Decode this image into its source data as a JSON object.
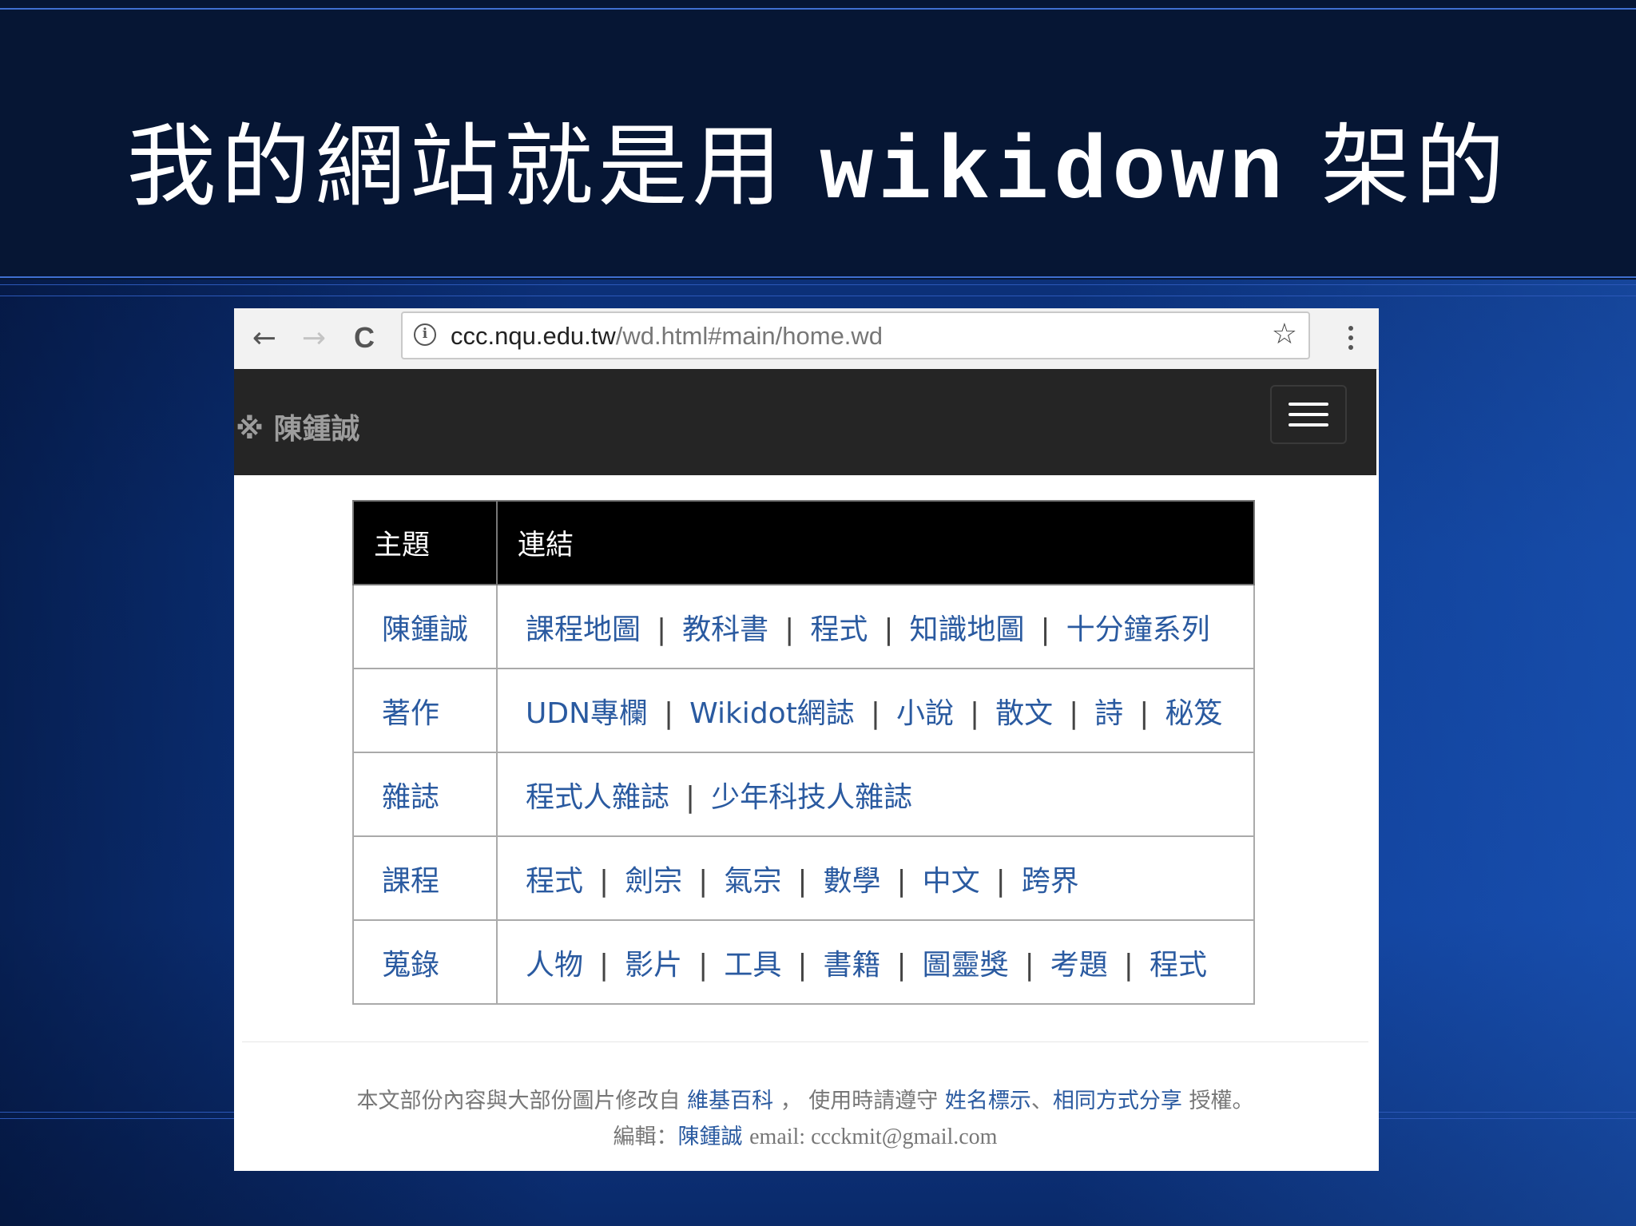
{
  "slide": {
    "title_cjk_before": "我的網站就是用",
    "title_latin": "wikidown",
    "title_cjk_after": "架的"
  },
  "browser": {
    "back_glyph": "←",
    "forward_glyph": "→",
    "reload_glyph": "C",
    "info_glyph": "i",
    "url_host": "ccc.nqu.edu.tw",
    "url_path": "/wd.html#main/home.wd",
    "star_glyph": "☆",
    "icons": [
      "back-arrow-icon",
      "forward-arrow-icon",
      "reload-icon",
      "info-icon",
      "bookmark-star-icon",
      "more-vertical-icon"
    ]
  },
  "site": {
    "brand": "※ 陳鍾誠",
    "menu_icon": "hamburger-menu-icon"
  },
  "table": {
    "headers": [
      "主題",
      "連結"
    ],
    "rows": [
      {
        "topic": "陳鍾誠",
        "links": [
          "課程地圖",
          "教科書",
          "程式",
          "知識地圖",
          "十分鐘系列"
        ]
      },
      {
        "topic": "著作",
        "links": [
          "UDN專欄",
          "Wikidot網誌",
          "小說",
          "散文",
          "詩",
          "秘笈"
        ]
      },
      {
        "topic": "雜誌",
        "links": [
          "程式人雜誌",
          "少年科技人雜誌"
        ]
      },
      {
        "topic": "課程",
        "links": [
          "程式",
          "劍宗",
          "氣宗",
          "數學",
          "中文",
          "跨界"
        ]
      },
      {
        "topic": "蒐錄",
        "links": [
          "人物",
          "影片",
          "工具",
          "書籍",
          "圖靈獎",
          "考題",
          "程式"
        ]
      }
    ],
    "separator": "|"
  },
  "footer": {
    "line1_prefix": "本文部份內容與大部份圖片修改自",
    "wiki_link": "維基百科",
    "line1_mid": "，  使用時請遵守",
    "license_link1": "姓名標示",
    "license_sep": "、",
    "license_link2": "相同方式分享",
    "line1_suffix": "授權。",
    "editor_label": "編輯：",
    "editor_link": "陳鍾誠",
    "email": "email: ccckmit@gmail.com"
  },
  "colors": {
    "title_band": "#061634",
    "navbar": "#252525",
    "table_header": "#000000",
    "link": "#2a5aa0"
  }
}
